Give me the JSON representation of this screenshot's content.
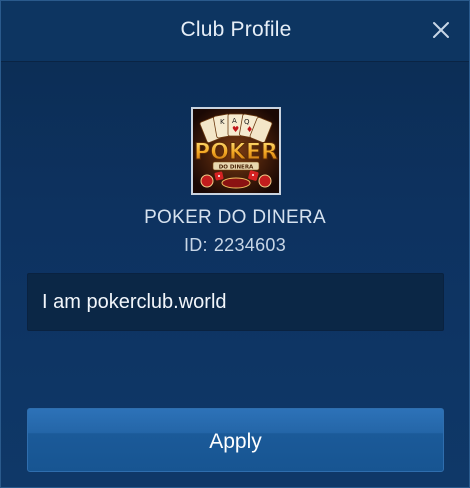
{
  "dialog": {
    "title": "Club Profile",
    "close_icon": "close-icon"
  },
  "club": {
    "name": "POKER DO DINERA",
    "id_label": "ID:",
    "id_value": "2234603",
    "logo": {
      "icon": "poker-club-logo",
      "text_main": "POKER",
      "text_sub": "DO DINERA"
    },
    "description": "I am pokerclub.world"
  },
  "actions": {
    "apply_label": "Apply"
  },
  "colors": {
    "background": "#0d3260",
    "header": "#0d3561",
    "button": "#2466a8",
    "text": "#d6e2ef"
  }
}
